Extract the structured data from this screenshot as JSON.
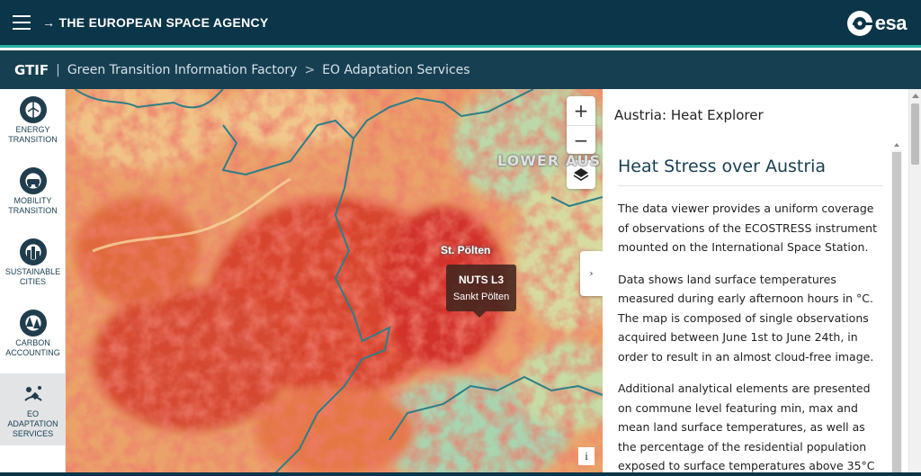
{
  "header": {
    "menu_icon": "hamburger-icon",
    "agency_title": "→ THE EUROPEAN SPACE AGENCY",
    "logo_text": "esa",
    "background": "#0b3548",
    "accent": "#28b2a4"
  },
  "breadcrumb": {
    "app": "GTIF",
    "separator": "|",
    "section": "Green Transition Information Factory",
    "arrow": ">",
    "page": "EO Adaptation Services"
  },
  "sidebar": {
    "items": [
      {
        "label_line1": "ENERGY",
        "label_line2": "TRANSITION",
        "icon": "wind-turbine-icon"
      },
      {
        "label_line1": "MOBILITY",
        "label_line2": "TRANSITION",
        "icon": "vehicles-icon"
      },
      {
        "label_line1": "SUSTAINABLE",
        "label_line2": "CITIES",
        "icon": "city-icon"
      },
      {
        "label_line1": "CARBON",
        "label_line2": "ACCOUNTING",
        "icon": "forest-icon"
      },
      {
        "label_line1": "EO",
        "label_line2": "ADAPTATION",
        "label_line3": "SERVICES",
        "icon": "satellite-icon",
        "active": true
      }
    ]
  },
  "map": {
    "zoom_in": "+",
    "zoom_out": "−",
    "region_label": "LOWER AUS",
    "place_label": "St. Pölten",
    "tooltip_title": "NUTS L3",
    "tooltip_value": "Sankt Pölten",
    "info": "i",
    "collapse": "›"
  },
  "panel": {
    "title": "Austria: Heat Explorer",
    "heading": "Heat Stress over Austria",
    "paragraphs": [
      "The data viewer provides a uniform coverage of observations of the ECOSTRESS instrument mounted on the International Space Station.",
      "Data shows land surface temperatures measured during early afternoon hours in °C. The map is composed of single observations acquired between June 1st to June 24th, in order to result in an almost cloud-free image.",
      "Additional analytical elements are presented on commune level featuring min, max and mean land surface temperatures, as well as the percentage of the residential population exposed to surface temperatures above 35°C"
    ]
  }
}
